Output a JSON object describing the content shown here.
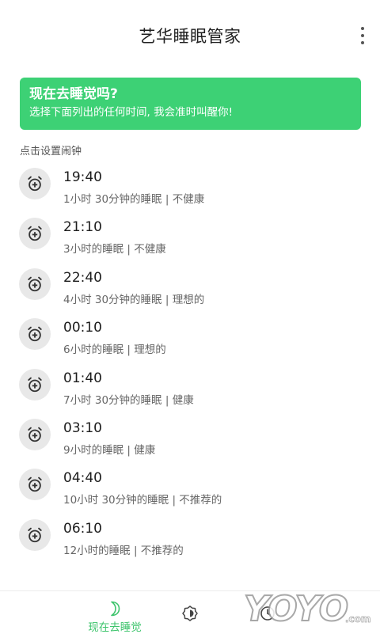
{
  "app": {
    "title": "艺华睡眠管家"
  },
  "banner": {
    "title": "现在去睡觉吗?",
    "subtitle": "选择下面列出的任何时间, 我会准时叫醒你!"
  },
  "section_label": "点击设置闹钟",
  "alarms": [
    {
      "time": "19:40",
      "desc": "1小时 30分钟的睡眠 | 不健康"
    },
    {
      "time": "21:10",
      "desc": "3小时的睡眠 | 不健康"
    },
    {
      "time": "22:40",
      "desc": "4小时 30分钟的睡眠 | 理想的"
    },
    {
      "time": "00:10",
      "desc": "6小时的睡眠 | 理想的"
    },
    {
      "time": "01:40",
      "desc": "7小时 30分钟的睡眠 | 健康"
    },
    {
      "time": "03:10",
      "desc": "9小时的睡眠 | 健康"
    },
    {
      "time": "04:40",
      "desc": "10小时 30分钟的睡眠 | 不推荐的"
    },
    {
      "time": "06:10",
      "desc": "12小时的睡眠 | 不推荐的"
    }
  ],
  "bottom_nav": {
    "tabs": [
      {
        "label": "现在去睡觉",
        "icon": "crescent-moon-icon",
        "active": true
      },
      {
        "label": "",
        "icon": "brightness-icon",
        "active": false
      },
      {
        "label": "",
        "icon": "clock-icon",
        "active": false
      }
    ]
  },
  "watermark": {
    "text": "YOYO",
    "suffix": ".com"
  },
  "colors": {
    "accent": "#3dd175",
    "nav_active": "#3dc46c",
    "icon_bg": "#e8e8e8"
  }
}
